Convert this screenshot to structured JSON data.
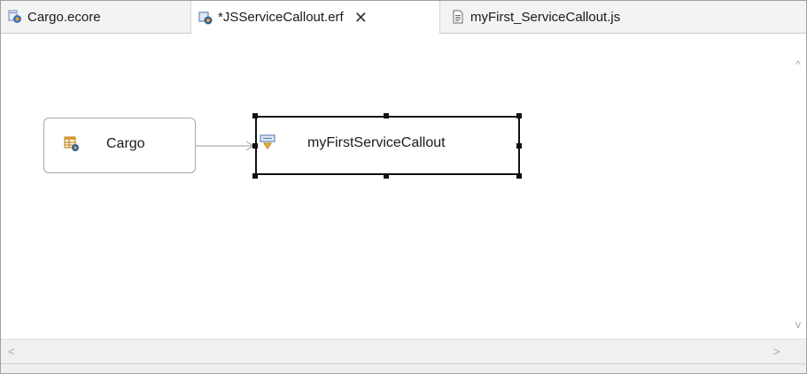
{
  "tabs": [
    {
      "label": "Cargo.ecore",
      "icon": "ecore-model-icon",
      "active": false
    },
    {
      "label": "*JSServiceCallout.erf",
      "icon": "erf-diagram-icon",
      "active": true,
      "close": "✕"
    },
    {
      "label": "myFirst_ServiceCallout.js",
      "icon": "js-file-icon",
      "active": false
    }
  ],
  "diagram": {
    "entity_node": {
      "label": "Cargo",
      "icon": "entity-table-icon"
    },
    "callout_node": {
      "label": "myFirstServiceCallout",
      "icon": "service-callout-icon",
      "selected": true
    }
  },
  "scrollbars": {
    "up": "^",
    "down": "v",
    "left": "<",
    "right": ">"
  }
}
